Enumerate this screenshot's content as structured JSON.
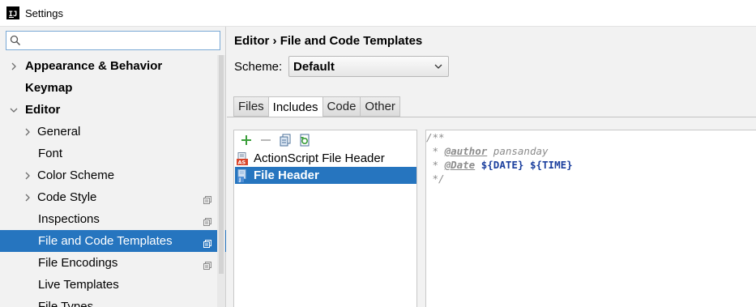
{
  "window": {
    "title": "Settings"
  },
  "search": {
    "placeholder": "",
    "value": ""
  },
  "sidebar": {
    "items": [
      {
        "label": "Appearance & Behavior",
        "expander": "collapsed",
        "bold": true,
        "copy_icon": false,
        "selected": false
      },
      {
        "label": "Keymap",
        "expander": "none",
        "bold": true,
        "copy_icon": false,
        "selected": false
      },
      {
        "label": "Editor",
        "expander": "expanded",
        "bold": true,
        "copy_icon": false,
        "selected": false
      },
      {
        "label": "General",
        "expander": "collapsed",
        "bold": false,
        "copy_icon": false,
        "selected": false
      },
      {
        "label": "Font",
        "expander": "none",
        "bold": false,
        "copy_icon": false,
        "selected": false
      },
      {
        "label": "Color Scheme",
        "expander": "collapsed",
        "bold": false,
        "copy_icon": false,
        "selected": false
      },
      {
        "label": "Code Style",
        "expander": "collapsed",
        "bold": false,
        "copy_icon": true,
        "selected": false
      },
      {
        "label": "Inspections",
        "expander": "none",
        "bold": false,
        "copy_icon": true,
        "selected": false
      },
      {
        "label": "File and Code Templates",
        "expander": "none",
        "bold": false,
        "copy_icon": true,
        "selected": true
      },
      {
        "label": "File Encodings",
        "expander": "none",
        "bold": false,
        "copy_icon": true,
        "selected": false
      },
      {
        "label": "Live Templates",
        "expander": "none",
        "bold": false,
        "copy_icon": false,
        "selected": false
      },
      {
        "label": "File Types",
        "expander": "none",
        "bold": false,
        "copy_icon": false,
        "selected": false
      }
    ]
  },
  "breadcrumb": {
    "parent": "Editor",
    "separator": "›",
    "current": "File and Code Templates"
  },
  "scheme": {
    "label": "Scheme:",
    "value": "Default"
  },
  "tabs": [
    {
      "label": "Files",
      "active": false
    },
    {
      "label": "Includes",
      "active": true
    },
    {
      "label": "Code",
      "active": false
    },
    {
      "label": "Other",
      "active": false
    }
  ],
  "toolbar": {
    "icons": [
      "add-icon",
      "remove-icon",
      "copy-icon",
      "reset-icon"
    ]
  },
  "templates": [
    {
      "label": "ActionScript File Header",
      "icon_text": "AS",
      "selected": false
    },
    {
      "label": "File Header",
      "icon_text": "J",
      "selected": true
    }
  ],
  "editor": {
    "line1": "/**",
    "line2_prefix": " * ",
    "line2_tag": "@author",
    "line2_text": " pansanday",
    "line3_prefix": " * ",
    "line3_tag": "@Date",
    "line3_sep": " ",
    "line3_var1": "${DATE}",
    "line3_var2": "${TIME}",
    "line4": " */"
  },
  "colors": {
    "selection": "#2675bf",
    "add_green": "#3a9e3a",
    "variable_blue": "#1b3f9e"
  }
}
